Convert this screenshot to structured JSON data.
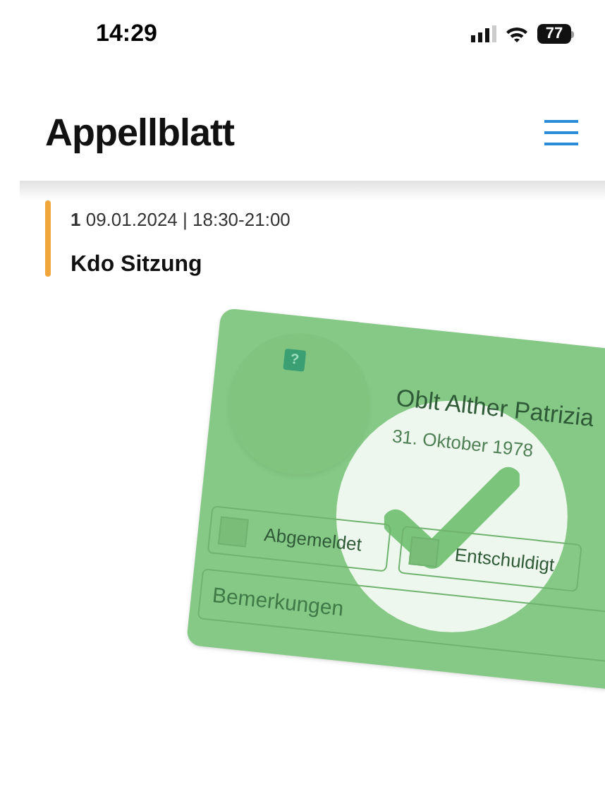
{
  "status_bar": {
    "time": "14:29",
    "battery": "77"
  },
  "header": {
    "title": "Appellblatt"
  },
  "entries": [
    {
      "meta": "**1** 09.01.2024 | 18:30-21:00",
      "title": "Kdo Sitzung",
      "color": "#f0a63a"
    }
  ],
  "swipe_card": {
    "badge": "?",
    "name": "Oblt Alther Patrizia",
    "date": "31. Oktober 1978",
    "options": [
      {
        "label": "Abgemeldet",
        "checked": false
      },
      {
        "label": "Entschuldigt",
        "checked": false
      }
    ],
    "remarks": {
      "placeholder": "Bemerkungen"
    }
  }
}
